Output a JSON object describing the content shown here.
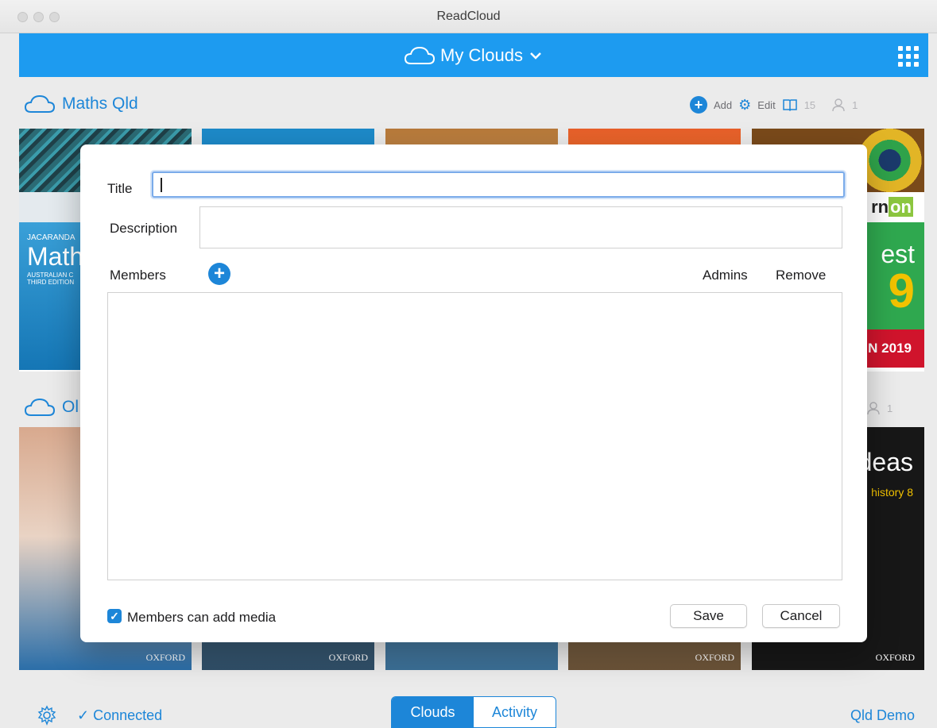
{
  "window": {
    "title": "ReadCloud"
  },
  "topbar": {
    "title": "My Clouds",
    "chevron": "chevron-down-icon",
    "apps_icon": "grid-icon",
    "color": "#1d9bf0"
  },
  "cloud1": {
    "name": "Maths Qld",
    "toolbar": {
      "add_label": "Add",
      "edit_label": "Edit",
      "books_count": "15",
      "members_count": "1"
    }
  },
  "cloud2": {
    "name_partial": "Ol",
    "members_count": "1"
  },
  "books_row1": [
    {
      "lines": [
        "JACARANDA",
        "Math",
        "AUSTRALIAN C",
        "THIRD EDITION"
      ]
    },
    {
      "lines": []
    },
    {
      "lines": []
    },
    {
      "lines": []
    },
    {
      "lines": [
        "rn",
        "on",
        "est",
        "9",
        "N 2019"
      ]
    }
  ],
  "books_row2": [
    {
      "lines": [
        "OXFORD"
      ]
    },
    {
      "lines": [
        "OXFORD"
      ]
    },
    {
      "lines": []
    },
    {
      "lines": [
        "OXFORD"
      ]
    },
    {
      "lines": [
        "deas",
        "history 8",
        "OXFORD"
      ]
    }
  ],
  "dialog": {
    "title_label": "Title",
    "title_value": "",
    "description_label": "Description",
    "description_value": "",
    "members_label": "Members",
    "admins_label": "Admins",
    "remove_label": "Remove",
    "members_can_add_label": "Members can add media",
    "members_can_add_checked": true,
    "save_label": "Save",
    "cancel_label": "Cancel"
  },
  "bottombar": {
    "status": "✓ Connected",
    "tabs": [
      {
        "label": "Clouds",
        "active": true
      },
      {
        "label": "Activity",
        "active": false
      }
    ],
    "account": "Qld Demo"
  },
  "colors": {
    "accent": "#1d86d8",
    "brand_bar": "#1d9bf0"
  }
}
